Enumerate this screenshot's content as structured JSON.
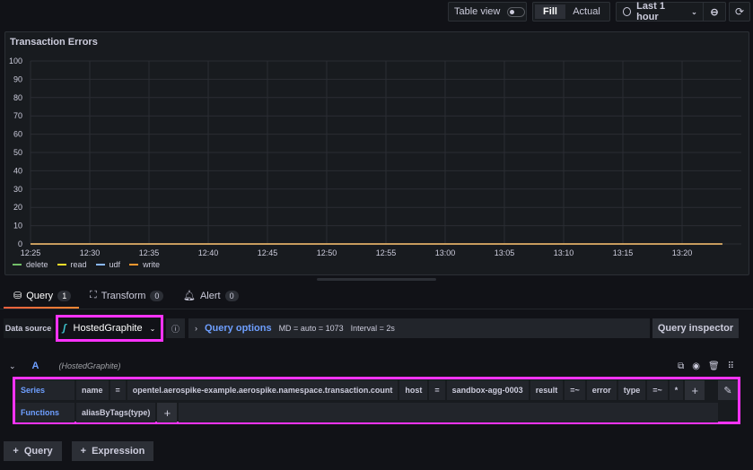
{
  "toolbar": {
    "table_view_label": "Table view",
    "table_view_on": false,
    "fill_label": "Fill",
    "actual_label": "Actual",
    "time_range": "Last 1 hour"
  },
  "panel": {
    "title": "Transaction Errors"
  },
  "chart_data": {
    "type": "line",
    "title": "Transaction Errors",
    "xlabel": "",
    "ylabel": "",
    "ylim": [
      0,
      100
    ],
    "yticks": [
      0,
      10,
      20,
      30,
      40,
      50,
      60,
      70,
      80,
      90,
      100
    ],
    "xticks": [
      "12:25",
      "12:30",
      "12:35",
      "12:40",
      "12:45",
      "12:50",
      "12:55",
      "13:00",
      "13:05",
      "13:10",
      "13:15",
      "13:20"
    ],
    "x_range_minutes": [
      0,
      58.4
    ],
    "grid": true,
    "legend_position": "bottom-left",
    "series": [
      {
        "name": "delete",
        "color": "#73bf69",
        "values": [
          0,
          0
        ]
      },
      {
        "name": "read",
        "color": "#fade2a",
        "values": [
          0,
          0
        ]
      },
      {
        "name": "udf",
        "color": "#8ab8ff",
        "values": [
          0,
          0
        ]
      },
      {
        "name": "write",
        "color": "#ff9830",
        "values": [
          0,
          0
        ]
      }
    ]
  },
  "tabs": [
    {
      "label": "Query",
      "count": "1",
      "icon": "database-icon"
    },
    {
      "label": "Transform",
      "count": "0",
      "icon": "transform-icon"
    },
    {
      "label": "Alert",
      "count": "0",
      "icon": "bell-icon"
    }
  ],
  "datasource": {
    "label": "Data source",
    "value": "HostedGraphite",
    "query_options_label": "Query options",
    "md": "MD = auto = 1073",
    "interval": "Interval = 2s",
    "query_inspector": "Query inspector"
  },
  "query": {
    "ref": "A",
    "datasource": "(HostedGraphite)",
    "series_label": "Series",
    "series_segments": [
      "name",
      "=",
      "opentel.aerospike-example.aerospike.namespace.transaction.count",
      "host",
      "=",
      "sandbox-agg-0003",
      "result",
      "=~",
      "error",
      "type",
      "=~",
      "*"
    ],
    "functions_label": "Functions",
    "functions": [
      "aliasByTags(type)"
    ]
  },
  "footer": {
    "add_query": "Query",
    "add_expression": "Expression"
  }
}
